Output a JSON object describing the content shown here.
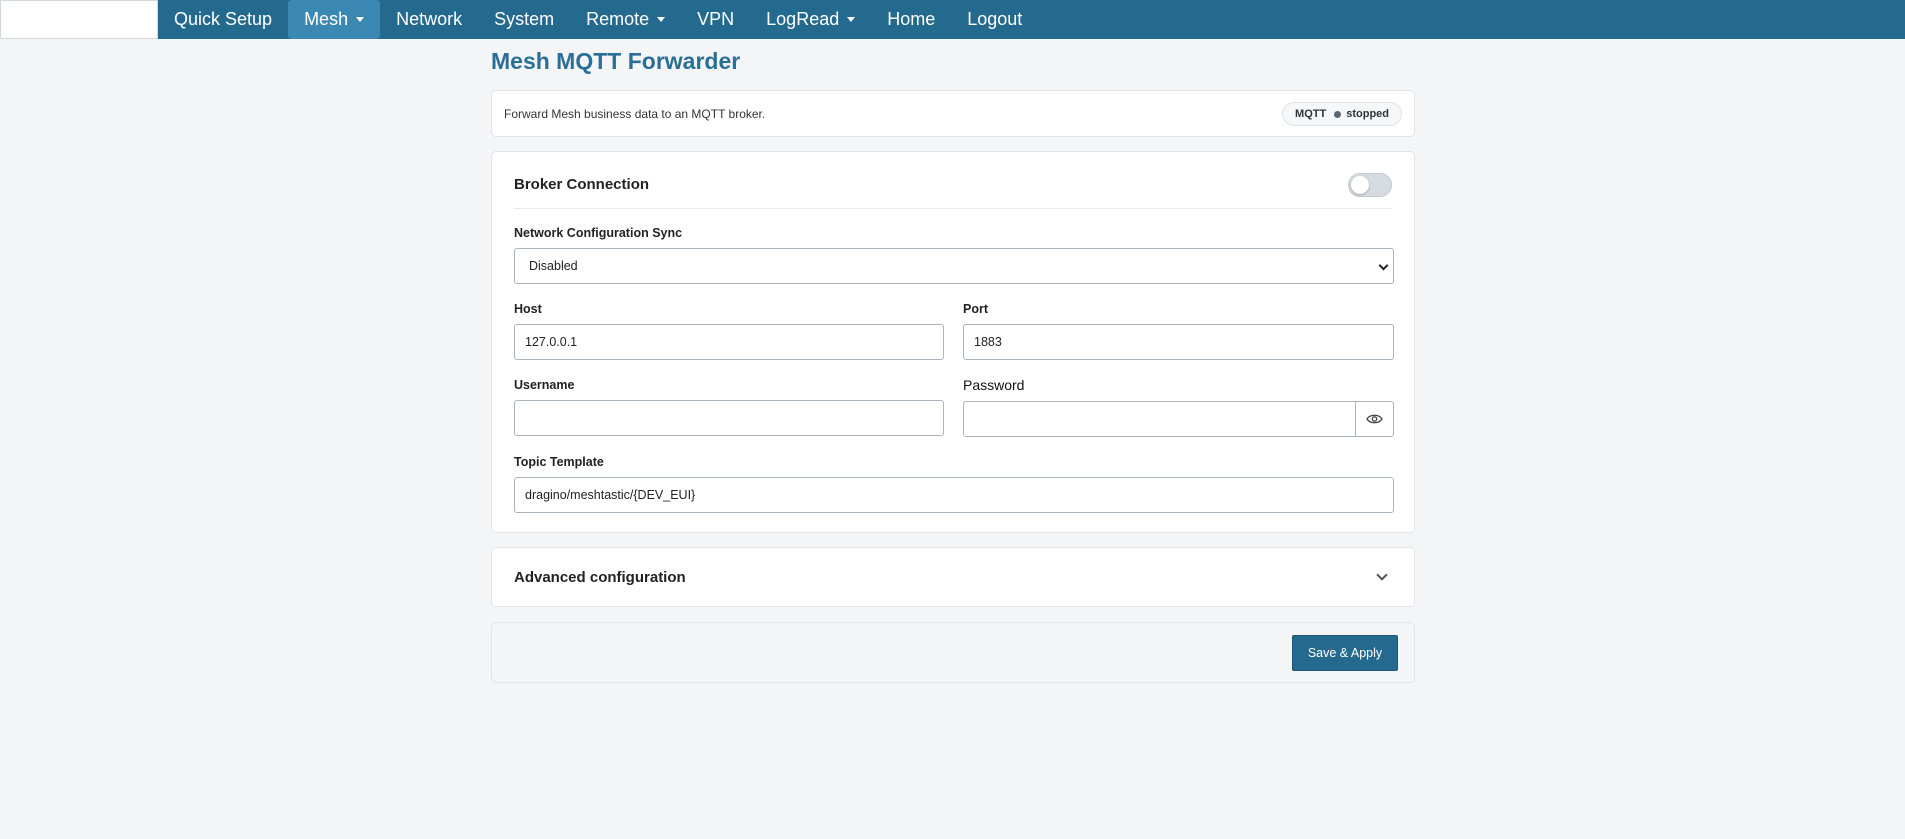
{
  "nav": {
    "items": [
      {
        "label": "Quick Setup",
        "dropdown": false,
        "active": false
      },
      {
        "label": "Mesh",
        "dropdown": true,
        "active": true
      },
      {
        "label": "Network",
        "dropdown": false,
        "active": false
      },
      {
        "label": "System",
        "dropdown": false,
        "active": false
      },
      {
        "label": "Remote",
        "dropdown": true,
        "active": false
      },
      {
        "label": "VPN",
        "dropdown": false,
        "active": false
      },
      {
        "label": "LogRead",
        "dropdown": true,
        "active": false
      },
      {
        "label": "Home",
        "dropdown": false,
        "active": false
      },
      {
        "label": "Logout",
        "dropdown": false,
        "active": false
      }
    ]
  },
  "page": {
    "title": "Mesh MQTT Forwarder",
    "description": "Forward Mesh business data to an MQTT broker.",
    "status_label": "MQTT",
    "status_value": "stopped"
  },
  "broker": {
    "title": "Broker Connection",
    "enabled": false,
    "sync_label": "Network Configuration Sync",
    "sync_value": "Disabled",
    "host_label": "Host",
    "host_value": "127.0.0.1",
    "port_label": "Port",
    "port_value": "1883",
    "username_label": "Username",
    "username_value": "",
    "password_label": "Password",
    "password_value": "",
    "topic_label": "Topic Template",
    "topic_value": "dragino/meshtastic/{DEV_EUI}"
  },
  "advanced": {
    "title": "Advanced configuration"
  },
  "actions": {
    "save_label": "Save & Apply"
  },
  "icons": {
    "password_toggle": "eye-icon",
    "advanced_toggle": "chevron-down-icon",
    "nav_dropdown": "caret-down-icon",
    "status_indicator": "status-dot-icon"
  },
  "colors": {
    "brand": "#246a8f",
    "nav_active": "#3b89b3",
    "title": "#2a6f97",
    "status_dot": "#59656f"
  }
}
